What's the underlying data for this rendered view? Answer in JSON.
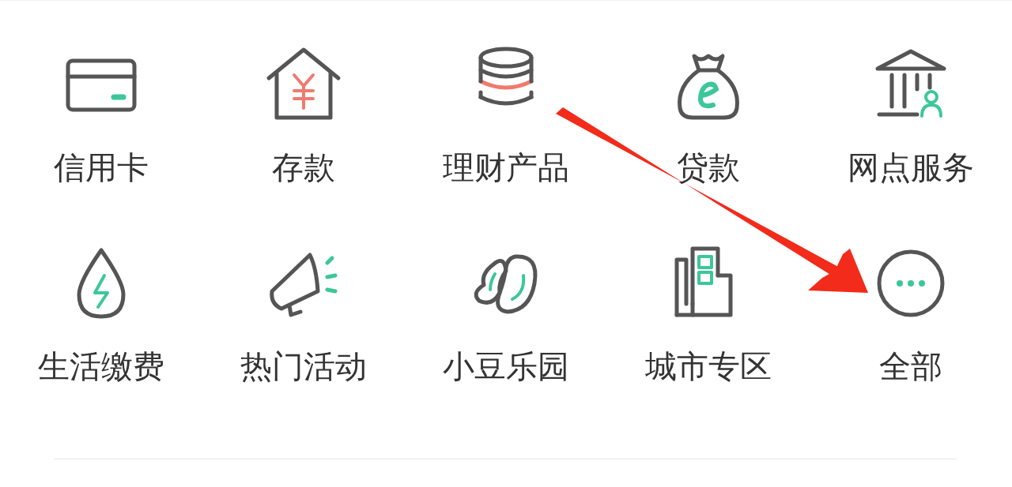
{
  "menu_grid": [
    {
      "label": "信用卡",
      "kind": "card"
    },
    {
      "label": "存款",
      "kind": "deposit"
    },
    {
      "label": "理财产品",
      "kind": "coins"
    },
    {
      "label": "贷款",
      "kind": "moneybag"
    },
    {
      "label": "网点服务",
      "kind": "bank"
    },
    {
      "label": "生活缴费",
      "kind": "drop"
    },
    {
      "label": "热门活动",
      "kind": "megaphone"
    },
    {
      "label": "小豆乐园",
      "kind": "beans"
    },
    {
      "label": "城市专区",
      "kind": "city"
    },
    {
      "label": "全部",
      "kind": "more"
    }
  ]
}
